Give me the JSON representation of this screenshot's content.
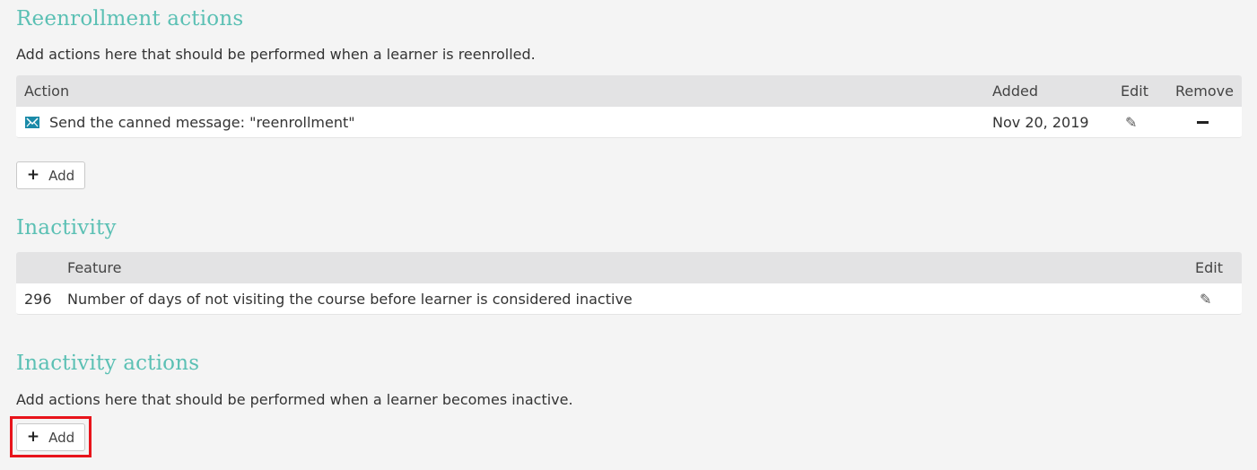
{
  "reenrollment": {
    "title": "Reenrollment actions",
    "description": "Add actions here that should be performed when a learner is reenrolled.",
    "columns": {
      "action": "Action",
      "added": "Added",
      "edit": "Edit",
      "remove": "Remove"
    },
    "rows": [
      {
        "action": "Send the canned message: \"reenrollment\"",
        "added": "Nov 20, 2019"
      }
    ],
    "add_label": "Add"
  },
  "inactivity": {
    "title": "Inactivity",
    "columns": {
      "feature": "Feature",
      "edit": "Edit"
    },
    "rows": [
      {
        "value": "296",
        "feature": "Number of days of not visiting the course before learner is considered inactive"
      }
    ]
  },
  "inactivity_actions": {
    "title": "Inactivity actions",
    "description": "Add actions here that should be performed when a learner becomes inactive.",
    "add_label": "Add"
  },
  "icons": {
    "plus": "+",
    "pencil": "✎"
  },
  "colors": {
    "title": "#5bc0b4",
    "header_bg": "#e3e3e4",
    "highlight": "#e8141b",
    "mail_icon": "#1a8aa8"
  }
}
